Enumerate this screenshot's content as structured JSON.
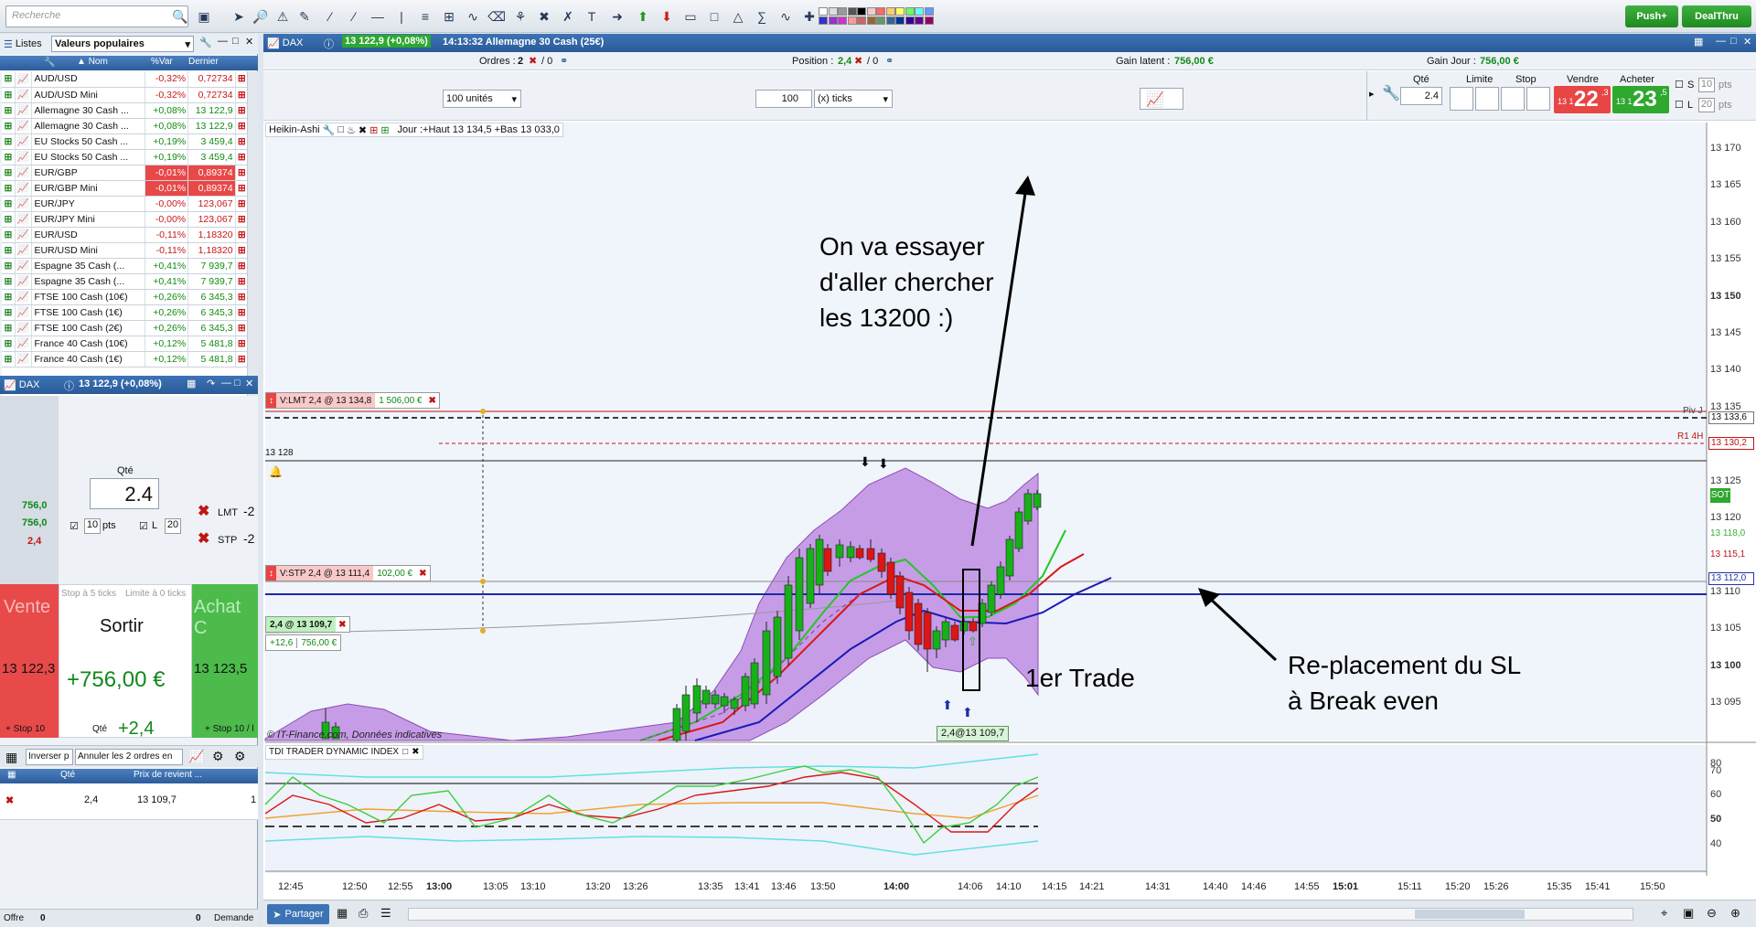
{
  "toolbar": {
    "search_placeholder": "Recherche",
    "push_label": "Push+",
    "dealthru_label": "DealThru"
  },
  "watchlist": {
    "tab_label": "Listes",
    "list_name": "Valeurs populaires",
    "col_name": "Nom",
    "col_var": "%Var",
    "col_last": "Dernier",
    "rows": [
      {
        "name": "AUD/USD",
        "var": "-0,32%",
        "last": "0,72734",
        "neg": true
      },
      {
        "name": "AUD/USD Mini",
        "var": "-0,32%",
        "last": "0,72734",
        "neg": true
      },
      {
        "name": "Allemagne 30 Cash ...",
        "var": "+0,08%",
        "last": "13 122,9",
        "neg": false
      },
      {
        "name": "Allemagne 30 Cash ...",
        "var": "+0,08%",
        "last": "13 122,9",
        "neg": false
      },
      {
        "name": "EU Stocks 50 Cash ...",
        "var": "+0,19%",
        "last": "3 459,4",
        "neg": false
      },
      {
        "name": "EU Stocks 50 Cash ...",
        "var": "+0,19%",
        "last": "3 459,4",
        "neg": false
      },
      {
        "name": "EUR/GBP",
        "var": "-0,01%",
        "last": "0,89374",
        "neg": true,
        "hl": true
      },
      {
        "name": "EUR/GBP Mini",
        "var": "-0,01%",
        "last": "0,89374",
        "neg": true,
        "hl": true
      },
      {
        "name": "EUR/JPY",
        "var": "-0,00%",
        "last": "123,067",
        "neg": true
      },
      {
        "name": "EUR/JPY Mini",
        "var": "-0,00%",
        "last": "123,067",
        "neg": true
      },
      {
        "name": "EUR/USD",
        "var": "-0,11%",
        "last": "1,18320",
        "neg": true
      },
      {
        "name": "EUR/USD Mini",
        "var": "-0,11%",
        "last": "1,18320",
        "neg": true
      },
      {
        "name": "Espagne 35 Cash (...",
        "var": "+0,41%",
        "last": "7 939,7",
        "neg": false
      },
      {
        "name": "Espagne 35 Cash (...",
        "var": "+0,41%",
        "last": "7 939,7",
        "neg": false
      },
      {
        "name": "FTSE 100 Cash (10€)",
        "var": "+0,26%",
        "last": "6 345,3",
        "neg": false
      },
      {
        "name": "FTSE 100 Cash (1€)",
        "var": "+0,26%",
        "last": "6 345,3",
        "neg": false
      },
      {
        "name": "FTSE 100 Cash (2€)",
        "var": "+0,26%",
        "last": "6 345,3",
        "neg": false
      },
      {
        "name": "France 40 Cash (10€)",
        "var": "+0,12%",
        "last": "5 481,8",
        "neg": false
      },
      {
        "name": "France 40 Cash (1€)",
        "var": "+0,12%",
        "last": "5 481,8",
        "neg": false
      }
    ]
  },
  "order_panel": {
    "title": "DAX",
    "quote": "13 122,9 (+0,08%)",
    "qty_label": "Qté",
    "qty_value": "2.4",
    "pts_value": "10",
    "pts_label": "pts",
    "l_label": "L",
    "l_value": "20",
    "spin1": "5",
    "spin2": "0",
    "lmt": "LMT",
    "stp": "STP",
    "lmt_val": "-2",
    "stp_val": "-2",
    "left_vals": [
      "756,0",
      "756,0",
      "2,4"
    ],
    "sell_label": "Vente",
    "buy_label": "Achat C",
    "sell_price": "13 122,3",
    "buy_price": "13 123,5",
    "stop5": "Stop à 5 ticks",
    "limit0": "Limite à 0 ticks",
    "exit_label": "Sortir",
    "pnl": "+756,00 €",
    "qty_small": "Qté",
    "qty_small_val": "+2,4",
    "stop10_left": "+ Stop 10",
    "stop10_right": "+ Stop 10 / l",
    "invert": "Inverser p",
    "cancel_both": "Annuler les 2 ordres en"
  },
  "positions": {
    "col_qty": "Qté",
    "col_price": "Prix de revient ...",
    "qty": "2,4",
    "price": "13 109,7",
    "extra": "1"
  },
  "status": {
    "offer": "Offre",
    "offer_val": "0",
    "demand_val": "0",
    "demand": "Demande"
  },
  "chart_header": {
    "symbol": "DAX",
    "quote": "13 122,9 (+0,08%)",
    "title": "14:13:32 Allemagne 30 Cash (25€)"
  },
  "info_bar": {
    "orders_label": "Ordres :",
    "orders_val": "2",
    "orders_slash": "/ 0",
    "position_label": "Position :",
    "position_val": "2,4",
    "position_slash": "/ 0",
    "latent_label": "Gain latent :",
    "latent_val": "756,00 €",
    "day_label": "Gain Jour :",
    "day_val": "756,00 €"
  },
  "controls": {
    "units": "100 unités",
    "ticks_val": "100",
    "ticks_unit": "(x) ticks",
    "qty_label": "Qté",
    "qty_val": "2.4",
    "limit_label": "Limite",
    "stop_label": "Stop",
    "sell_label": "Vendre",
    "buy_label": "Acheter",
    "sell_big": "22",
    "sell_small": "13 1",
    "sell_sup": ",3",
    "buy_big": "23",
    "buy_small": "13 1",
    "buy_sup": ",5",
    "s_label": "S",
    "s_val": "10",
    "s_pts": "pts",
    "l_label": "L",
    "l_val": "20",
    "l_pts": "pts"
  },
  "chart_labels": {
    "type": "Heikin-Ashi",
    "ohlc": "Jour :+Haut 13 134,5 +Bas 13 033,0",
    "copyright": "© IT-Finance.com, Données indicatives",
    "level_label": "13 128",
    "pivot": "Piv J",
    "r1": "R1 4H",
    "sot": "SOT"
  },
  "orders_on_chart": [
    {
      "label": "V:LMT 2,4 @ 13 134,8",
      "gain": "1 506,00 €"
    },
    {
      "label": "V:STP 2,4 @ 13 111,4",
      "gain": "102,00 €"
    },
    {
      "label": "2,4 @ 13 109,7",
      "pts": "+12,6",
      "gain": "756,00 €"
    }
  ],
  "trade_marker": "2,4@13 109,7",
  "annotations": {
    "top": [
      "On va essayer",
      "d'aller chercher",
      "les 13200 :)"
    ],
    "trade": "1er Trade",
    "sl": [
      "Re-placement du SL",
      "à Break even"
    ]
  },
  "price_axis": [
    "13 170",
    "13 165",
    "13 160",
    "13 155",
    "13 150",
    "13 145",
    "13 140",
    "13 135",
    "13 130",
    "13 125",
    "13 120",
    "13 115",
    "13 110",
    "13 105",
    "13 100",
    "13 095"
  ],
  "price_tags": {
    "p1": "13 133,6",
    "p2": "13 130,2",
    "p3": "13 118,0",
    "p4": "13 115,1",
    "p5": "13 112,0"
  },
  "indicator": {
    "title": "TDI TRADER DYNAMIC INDEX",
    "axis": [
      "70",
      "60",
      "50",
      "40"
    ],
    "extra": "80"
  },
  "time_axis": [
    "12:45",
    "12:50",
    "12:55",
    "13:00",
    "13:05",
    "13:10",
    "13:20",
    "13:26",
    "13:35",
    "13:41",
    "13:46",
    "13:50",
    "14:00",
    "14:06",
    "14:10",
    "14:15",
    "14:21",
    "14:31",
    "14:40",
    "14:46",
    "14:55",
    "15:01",
    "15:11",
    "15:20",
    "15:26",
    "15:35",
    "15:41",
    "15:50"
  ],
  "bottom": {
    "share": "Partager"
  },
  "colors": {
    "bull": "#18b018",
    "bear": "#dd1515",
    "band": "#b87fe0",
    "accent": "#2a5a98"
  }
}
